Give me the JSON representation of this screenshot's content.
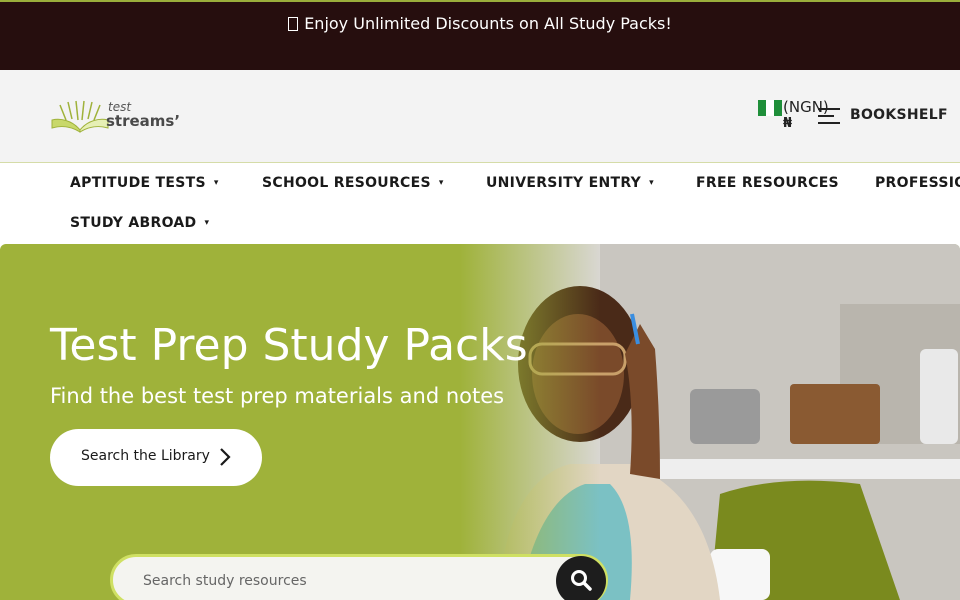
{
  "promo": {
    "icon": "gift-icon",
    "text": "Enjoy Unlimited Discounts on All Study Packs!"
  },
  "header": {
    "logo_top": "test",
    "logo_bottom": "streams’",
    "currency_code": "(NGN)",
    "currency_symbol": "₦",
    "currency_flag": "nigeria-flag-icon",
    "menu_icon": "hamburger-menu-icon",
    "bookshelf_label": "BOOKSHELF"
  },
  "nav": {
    "items": [
      {
        "label": "APTITUDE TESTS",
        "dropdown": true
      },
      {
        "label": "SCHOOL RESOURCES",
        "dropdown": true
      },
      {
        "label": "UNIVERSITY ENTRY",
        "dropdown": true
      },
      {
        "label": "FREE RESOURCES",
        "dropdown": false
      },
      {
        "label": "PROFESSIO",
        "dropdown": false
      },
      {
        "label": "STUDY ABROAD",
        "dropdown": true
      }
    ],
    "caret": "▾"
  },
  "hero": {
    "title": "Test Prep Study Packs",
    "subtitle": "Find the best test prep materials and notes",
    "button_label": "Search the Library",
    "button_icon": "chevron-right-icon",
    "search_placeholder": "Search study resources",
    "search_icon": "search-icon"
  },
  "colors": {
    "promo_bg": "#260e0e",
    "accent_green": "#9fb23a",
    "search_border": "#cfe063",
    "dark": "#1d1d1d"
  }
}
